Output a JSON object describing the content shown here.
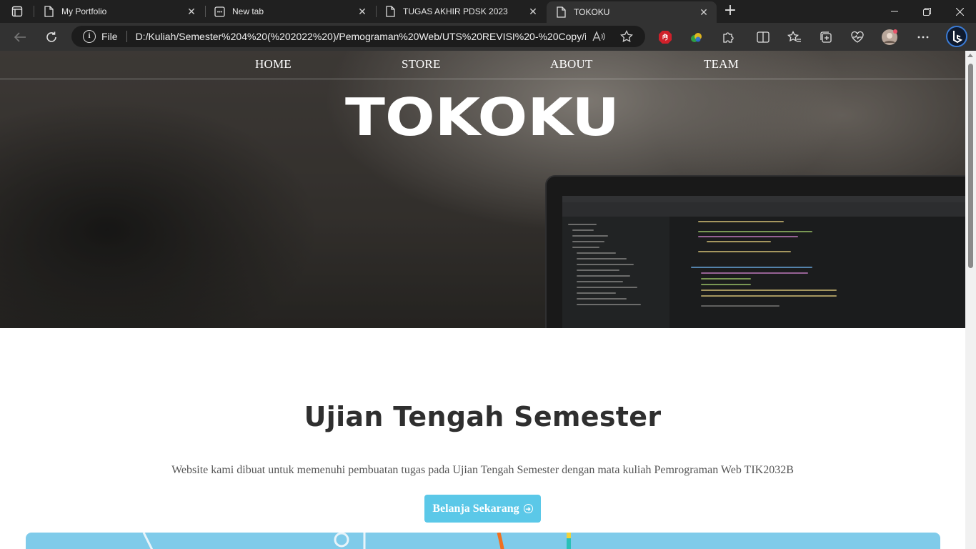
{
  "browser": {
    "tabs": [
      {
        "title": "My Portfolio",
        "active": false
      },
      {
        "title": "New tab",
        "active": false
      },
      {
        "title": "TUGAS AKHIR PDSK 2023",
        "active": false
      },
      {
        "title": "TOKOKU",
        "active": true
      }
    ],
    "address": {
      "scheme_label": "File",
      "url": "D:/Kuliah/Semester%204%20(%202022%20)/Pemograman%20Web/UTS%20REVISI%20-%20Copy/in..."
    },
    "colors": {
      "tabbar": "#202020",
      "toolbar": "#323232",
      "omnibox": "#1c1c1c"
    }
  },
  "page": {
    "nav": [
      "HOME",
      "STORE",
      "ABOUT",
      "TEAM"
    ],
    "logo_text": "TOKOKU",
    "headline": "Ujian Tengah Semester",
    "description": "Website kami dibuat untuk memenuhi pembuatan tugas pada Ujian Tengah Semester dengan mata kuliah Pemrograman Web TIK2032B",
    "cta_label": "Belanja Sekarang",
    "colors": {
      "cta": "#5bc8e8",
      "headline": "#2f2f2f",
      "strip": "#7fcbea"
    }
  }
}
